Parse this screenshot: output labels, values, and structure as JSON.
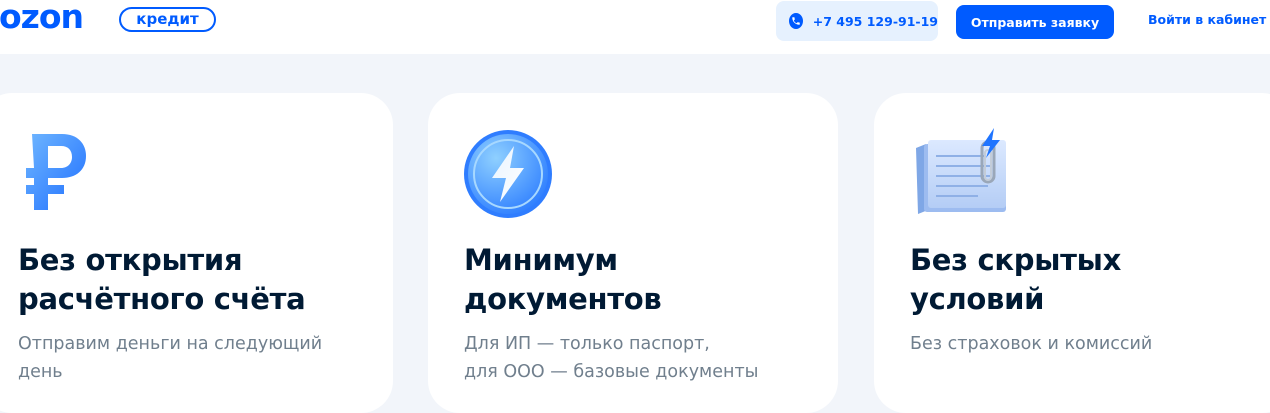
{
  "header": {
    "logo_text": "ozon",
    "credit_label": "кредит",
    "phone": "+7 495 129-91-19",
    "apply_label": "Отправить заявку",
    "login_label": "Войти в кабинет"
  },
  "colors": {
    "brand": "#005bff",
    "title": "#001a34",
    "text_muted": "#707f8d",
    "background": "#f2f5fa"
  },
  "cards": [
    {
      "icon": "ruble-icon",
      "title_lines": [
        "Без открытия",
        "расчётного счёта"
      ],
      "desc_lines": [
        "Отправим деньги на следующий",
        "день"
      ]
    },
    {
      "icon": "lightning-coin-icon",
      "title_lines": [
        "Минимум",
        "документов"
      ],
      "desc_lines": [
        "Для ИП — только паспорт,",
        "для ООО — базовые документы"
      ]
    },
    {
      "icon": "documents-clip-icon",
      "title_lines": [
        "Без скрытых",
        "условий"
      ],
      "desc_lines": [
        "Без страховок и комиссий"
      ]
    }
  ]
}
